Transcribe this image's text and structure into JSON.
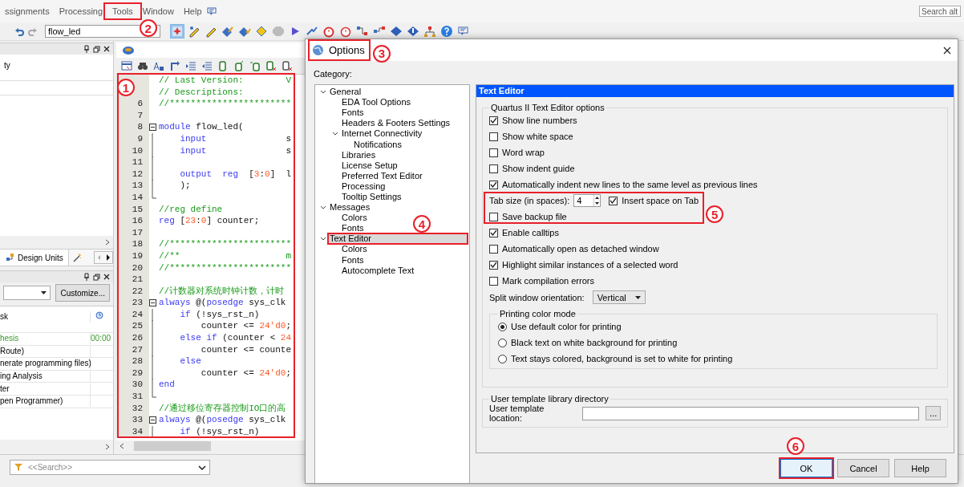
{
  "menu_bar": {
    "items": [
      {
        "label": "ssignments"
      },
      {
        "label": "Processing"
      },
      {
        "label": "Tools"
      },
      {
        "label": "Window"
      },
      {
        "label": "Help"
      }
    ],
    "search": {
      "placeholder": "Search alt"
    }
  },
  "toolbar": {
    "project": "flow_led"
  },
  "project_pane": {
    "rows": [
      {
        "text": "ty"
      }
    ],
    "tab": "Design Units"
  },
  "tasks_pane": {
    "customize_button": "Customize...",
    "header": "sk",
    "rows": [
      {
        "task": "hesis",
        "time": "00:00",
        "completed": true
      },
      {
        "task": "Route)",
        "completed": false
      },
      {
        "task": "nerate programming files)",
        "completed": false
      },
      {
        "task": "ing Analysis",
        "completed": false
      },
      {
        "task": "ter",
        "completed": false
      },
      {
        "task": "pen Programmer)",
        "completed": false
      }
    ]
  },
  "editor": {
    "lines": [
      {
        "kind": "none",
        "segments": [
          {
            "kind": "comment",
            "text": "// Last Version:        V"
          }
        ]
      },
      {
        "kind": "none",
        "segments": [
          {
            "kind": "comment",
            "text": "// Descriptions:"
          }
        ]
      },
      {
        "number": "6",
        "kind": "none",
        "segments": [
          {
            "kind": "comment",
            "text": "//***********************"
          }
        ]
      },
      {
        "number": "7",
        "kind": "none"
      },
      {
        "number": "8",
        "kind": "open",
        "segments": [
          {
            "kind": "keyword",
            "text": "module"
          },
          {
            "kind": "plain",
            "text": " flow_led("
          }
        ]
      },
      {
        "number": "9",
        "kind": "inner",
        "segments": [
          {
            "kind": "keyword",
            "text": "    input"
          },
          {
            "kind": "plain",
            "text": "               s"
          }
        ]
      },
      {
        "number": "10",
        "kind": "inner",
        "segments": [
          {
            "kind": "keyword",
            "text": "    input"
          },
          {
            "kind": "plain",
            "text": "               s"
          }
        ]
      },
      {
        "number": "11",
        "kind": "inner"
      },
      {
        "number": "12",
        "kind": "inner",
        "segments": [
          {
            "kind": "keyword",
            "text": "    output  reg"
          },
          {
            "kind": "plain",
            "text": "  ["
          },
          {
            "kind": "number",
            "text": "3"
          },
          {
            "kind": "plain",
            "text": ":"
          },
          {
            "kind": "number",
            "text": "0"
          },
          {
            "kind": "plain",
            "text": "]  l"
          }
        ]
      },
      {
        "number": "13",
        "kind": "inner",
        "segments": [
          {
            "kind": "plain",
            "text": "    );"
          }
        ]
      },
      {
        "number": "14",
        "kind": "close"
      },
      {
        "number": "15",
        "kind": "none",
        "segments": [
          {
            "kind": "comment",
            "text": "//reg define"
          }
        ]
      },
      {
        "number": "16",
        "kind": "none",
        "segments": [
          {
            "kind": "keyword",
            "text": "reg"
          },
          {
            "kind": "plain",
            "text": " ["
          },
          {
            "kind": "number",
            "text": "23"
          },
          {
            "kind": "plain",
            "text": ":"
          },
          {
            "kind": "number",
            "text": "0"
          },
          {
            "kind": "plain",
            "text": "] counter;"
          }
        ]
      },
      {
        "number": "17",
        "kind": "none"
      },
      {
        "number": "18",
        "kind": "none",
        "segments": [
          {
            "kind": "comment",
            "text": "//***********************"
          }
        ]
      },
      {
        "number": "19",
        "kind": "none",
        "segments": [
          {
            "kind": "comment",
            "text": "//**                    m"
          }
        ]
      },
      {
        "number": "20",
        "kind": "none",
        "segments": [
          {
            "kind": "comment",
            "text": "//***********************"
          }
        ]
      },
      {
        "number": "21",
        "kind": "none"
      },
      {
        "number": "22",
        "kind": "none",
        "segments": [
          {
            "kind": "comment",
            "text": "//计数器对系统时钟计数，计时"
          }
        ]
      },
      {
        "number": "23",
        "kind": "open",
        "segments": [
          {
            "kind": "keyword",
            "text": "always"
          },
          {
            "kind": "plain",
            "text": " @("
          },
          {
            "kind": "keyword",
            "text": "posedge"
          },
          {
            "kind": "plain",
            "text": " sys_clk"
          }
        ]
      },
      {
        "number": "24",
        "kind": "inner",
        "segments": [
          {
            "kind": "keyword",
            "text": "    if"
          },
          {
            "kind": "plain",
            "text": " (!sys_rst_n)"
          }
        ]
      },
      {
        "number": "25",
        "kind": "inner",
        "segments": [
          {
            "kind": "plain",
            "text": "        counter <= "
          },
          {
            "kind": "number",
            "text": "24'd0"
          },
          {
            "kind": "plain",
            "text": ";"
          }
        ]
      },
      {
        "number": "26",
        "kind": "inner",
        "segments": [
          {
            "kind": "keyword",
            "text": "    else if"
          },
          {
            "kind": "plain",
            "text": " (counter < "
          },
          {
            "kind": "number",
            "text": "24"
          }
        ]
      },
      {
        "number": "27",
        "kind": "inner",
        "segments": [
          {
            "kind": "plain",
            "text": "        counter <= counte"
          }
        ]
      },
      {
        "number": "28",
        "kind": "inner",
        "segments": [
          {
            "kind": "keyword",
            "text": "    else"
          }
        ]
      },
      {
        "number": "29",
        "kind": "inner",
        "segments": [
          {
            "kind": "plain",
            "text": "        counter <= "
          },
          {
            "kind": "number",
            "text": "24'd0"
          },
          {
            "kind": "plain",
            "text": ";"
          }
        ]
      },
      {
        "number": "30",
        "kind": "inner",
        "segments": [
          {
            "kind": "keyword",
            "text": "end"
          }
        ]
      },
      {
        "number": "31",
        "kind": "close"
      },
      {
        "number": "32",
        "kind": "none",
        "segments": [
          {
            "kind": "comment",
            "text": "//通过移位寄存器控制IO口的高"
          }
        ]
      },
      {
        "number": "33",
        "kind": "open",
        "segments": [
          {
            "kind": "keyword",
            "text": "always"
          },
          {
            "kind": "plain",
            "text": " @("
          },
          {
            "kind": "keyword",
            "text": "posedge"
          },
          {
            "kind": "plain",
            "text": " sys_clk"
          }
        ]
      },
      {
        "number": "34",
        "kind": "inner",
        "segments": [
          {
            "kind": "keyword",
            "text": "    if"
          },
          {
            "kind": "plain",
            "text": " (!sys_rst_n)"
          }
        ]
      }
    ]
  },
  "search_bar": {
    "placeholder": "<<Search>>"
  },
  "dialog": {
    "title": "Options",
    "category_label": "Category:",
    "tree": [
      {
        "label": "General",
        "expanded": true,
        "selected": false,
        "children": [
          {
            "label": "EDA Tool Options",
            "selected": false
          },
          {
            "label": "Fonts",
            "selected": false
          },
          {
            "label": "Headers & Footers Settings",
            "selected": false
          },
          {
            "label": "Internet Connectivity",
            "expanded": true,
            "selected": false,
            "children": [
              {
                "label": "Notifications",
                "selected": false
              }
            ]
          },
          {
            "label": "Libraries",
            "selected": false
          },
          {
            "label": "License Setup",
            "selected": false
          },
          {
            "label": "Preferred Text Editor",
            "selected": false
          },
          {
            "label": "Processing",
            "selected": false
          },
          {
            "label": "Tooltip Settings",
            "selected": false
          }
        ]
      },
      {
        "label": "Messages",
        "expanded": true,
        "selected": false,
        "children": [
          {
            "label": "Colors",
            "selected": false
          },
          {
            "label": "Fonts",
            "selected": false
          }
        ]
      },
      {
        "label": "Text Editor",
        "expanded": true,
        "selected": true,
        "children": [
          {
            "label": "Colors",
            "selected": false
          },
          {
            "label": "Fonts",
            "selected": false
          },
          {
            "label": "Autocomplete Text",
            "selected": false
          }
        ]
      }
    ],
    "panel_title": "Text Editor",
    "group_title": "Quartus II Text Editor options",
    "options": [
      {
        "kind": "checkbox",
        "label": "Show line numbers",
        "checked": true
      },
      {
        "kind": "checkbox",
        "label": "Show white space",
        "checked": false
      },
      {
        "kind": "checkbox",
        "label": "Word wrap",
        "checked": false
      },
      {
        "kind": "checkbox",
        "label": "Show indent guide",
        "checked": false
      },
      {
        "kind": "checkbox",
        "label": "Automatically indent new lines to the same level as previous lines",
        "checked": true
      },
      {
        "kind": "spin",
        "label": "Tab size (in spaces):",
        "value": "4",
        "option": {
          "label": "Insert space on Tab",
          "checked": true
        }
      },
      {
        "kind": "checkbox",
        "label": "Save backup file",
        "checked": false
      },
      {
        "kind": "checkbox",
        "label": "Enable calltips",
        "checked": true
      },
      {
        "kind": "checkbox",
        "label": "Automatically open as detached window",
        "checked": false
      },
      {
        "kind": "checkbox",
        "label": "Highlight similar instances of a selected word",
        "checked": true
      },
      {
        "kind": "checkbox",
        "label": "Mark compilation errors",
        "checked": false
      },
      {
        "kind": "select",
        "label": "Split window orientation:",
        "value": "Vertical"
      }
    ],
    "print_group": {
      "title": "Printing color mode",
      "options": [
        {
          "label": "Use default color for printing",
          "selected": true
        },
        {
          "label": "Black text on white background for printing",
          "selected": false
        },
        {
          "label": "Text stays colored, background is set to white for printing",
          "selected": false
        }
      ]
    },
    "template_group": {
      "title": "User template library directory",
      "label": "User template location:",
      "browse_button": "..."
    },
    "buttons": [
      {
        "label": "OK",
        "default": true
      },
      {
        "label": "Cancel",
        "default": false
      },
      {
        "label": "Help",
        "default": false
      }
    ]
  },
  "annotations": [
    {
      "label": "1"
    },
    {
      "label": "2"
    },
    {
      "label": "3"
    },
    {
      "label": "4"
    },
    {
      "label": "5"
    },
    {
      "label": "6"
    }
  ]
}
